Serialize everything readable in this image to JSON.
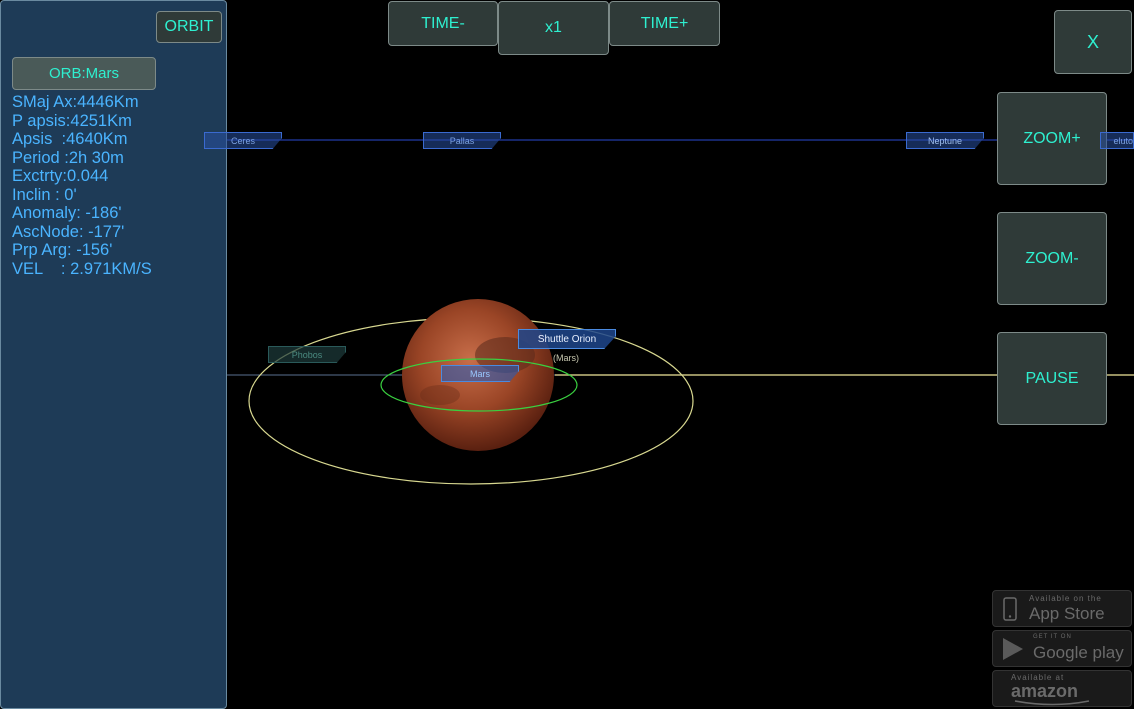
{
  "hud": {
    "time_minus": "TIME-",
    "time_rate": "x1",
    "time_plus": "TIME+",
    "close": "X",
    "zoom_in": "ZOOM+",
    "zoom_out": "ZOOM-",
    "pause": "PAUSE"
  },
  "panel": {
    "orbit_button": "ORBIT",
    "orbit_target": "ORB:Mars",
    "stats": [
      "SMaj Ax:4446Km",
      "P apsis:4251Km",
      "Apsis  :4640Km",
      "Period :2h 30m",
      "Exctrty:0.044",
      "Inclin : 0'",
      "Anomaly: -186'",
      "AscNode: -177'",
      "Prp Arg: -156'",
      "VEL    : 2.971KM/S"
    ]
  },
  "labels": {
    "ceres": "Ceres",
    "pallas": "Pallas",
    "neptune": "Neptune",
    "edge": "eluto",
    "phobos": "Phobos",
    "shuttle": "Shuttle Orion",
    "shuttle_parent": "(Mars)",
    "mars": "Mars"
  },
  "stores": {
    "apple_small": "Available on the",
    "apple_big": "App Store",
    "google_small": "GET IT ON",
    "google_big": "Google play",
    "amazon_small": "Available at",
    "amazon_big": "amazon"
  },
  "colors": {
    "panel_bg": "#1e3b57",
    "button_bg": "#2f3a38",
    "button_text": "#2ef0d0",
    "stats_text": "#4ab4ff",
    "orbit_outer": "#d8d890",
    "orbit_inner": "#3ad040",
    "line_blue": "#2a4ad0"
  },
  "icons": [
    "phone-icon",
    "play-triangle-icon",
    "amazon-smile-icon",
    "mars-planet"
  ]
}
